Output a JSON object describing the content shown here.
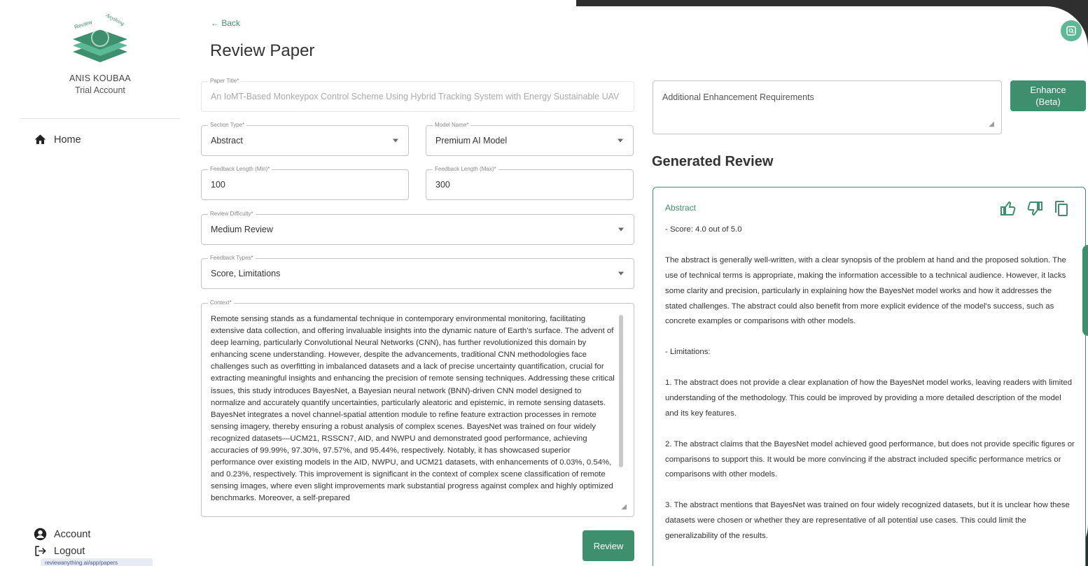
{
  "user": {
    "name": "ANIS KOUBAA",
    "role": "Trial Account"
  },
  "logo": {
    "text_top": "Review",
    "text_side": "Anything"
  },
  "nav": {
    "home": "Home",
    "account": "Account",
    "logout": "Logout"
  },
  "url_hint": "reviewanything.ai/app/papers",
  "header": {
    "back": "← Back",
    "title": "Review Paper"
  },
  "form": {
    "paper_title": {
      "label": "Paper Title*",
      "value": "An IoMT-Based Monkeypox Control Scheme Using Hybrid Tracking System with Energy Sustainable UAV"
    },
    "section_type": {
      "label": "Section Type*",
      "value": "Abstract"
    },
    "model_name": {
      "label": "Model Name*",
      "value": "Premium AI Model"
    },
    "feedback_min": {
      "label": "Feedback Length (Min)*",
      "value": "100"
    },
    "feedback_max": {
      "label": "Feedback Length (Max)*",
      "value": "300"
    },
    "difficulty": {
      "label": "Review Difficulty*",
      "value": "Medium Review"
    },
    "feedback_types": {
      "label": "Feedback Types*",
      "value": "Score, Limitations"
    },
    "context": {
      "label": "Context*",
      "value": "Remote sensing stands as a fundamental technique in contemporary environmental monitoring, facilitating extensive data collection, and offering invaluable insights into the dynamic nature of Earth's surface. The advent of deep learning, particularly Convolutional Neural Networks (CNN), has further revolutionized this domain by enhancing scene understanding. However, despite the advancements, traditional CNN methodologies face challenges such as overfitting in imbalanced datasets and a lack of precise uncertainty quantification, crucial for extracting meaningful insights and enhancing the precision of remote sensing techniques. Addressing these critical issues, this study introduces BayesNet, a Bayesian neural network (BNN)-driven CNN model designed to normalize and accurately quantify uncertainties, particularly aleatoric and epistemic, in remote sensing datasets. BayesNet integrates a novel channel-spatial attention module to refine feature extraction processes in remote sensing imagery, thereby ensuring a robust analysis of complex scenes. BayesNet was trained on four widely recognized datasets—UCM21, RSSCN7, AID, and NWPU and demonstrated good performance, achieving accuracies of 99.99%, 97.30%, 97.57%, and 95.44%, respectively. Notably, it has showcased superior performance over existing models in the AID, NWPU, and UCM21 datasets, with enhancements of 0.03%, 0.54%, and 0.23%, respectively. This improvement is significant in the context of complex scene classification of remote sensing images, where even slight improvements mark substantial progress against complex and highly optimized benchmarks. Moreover, a self-prepared"
    },
    "review_button": "Review"
  },
  "enhance": {
    "placeholder": "Additional Enhancement Requirements",
    "button_line1": "Enhance",
    "button_line2": "(Beta)"
  },
  "generated": {
    "title": "Generated Review",
    "section": "Abstract",
    "paragraphs": [
      "- Score: 4.0 out of 5.0",
      "The abstract is generally well-written, with a clear synopsis of the problem at hand and the proposed solution. The use of technical terms is appropriate, making the information accessible to a technical audience. However, it lacks some clarity and precision, particularly in explaining how the BayesNet model works and how it addresses the stated challenges. The abstract could also benefit from more explicit evidence of the model's success, such as concrete examples or comparisons with other models.",
      "- Limitations:",
      "1. The abstract does not provide a clear explanation of how the BayesNet model works, leaving readers with limited understanding of the methodology. This could be improved by providing a more detailed description of the model and its key features.",
      "2. The abstract claims that the BayesNet model achieved good performance, but does not provide specific figures or comparisons to support this. It would be more convincing if the abstract included specific performance metrics or comparisons with other models.",
      "3. The abstract mentions that BayesNet was trained on four widely recognized datasets, but it is unclear how these datasets were chosen or whether they are representative of all potential use cases. This could limit the generalizability of the results."
    ]
  },
  "colors": {
    "accent": "#3d8f6e",
    "frame": "#2f2f2f"
  }
}
